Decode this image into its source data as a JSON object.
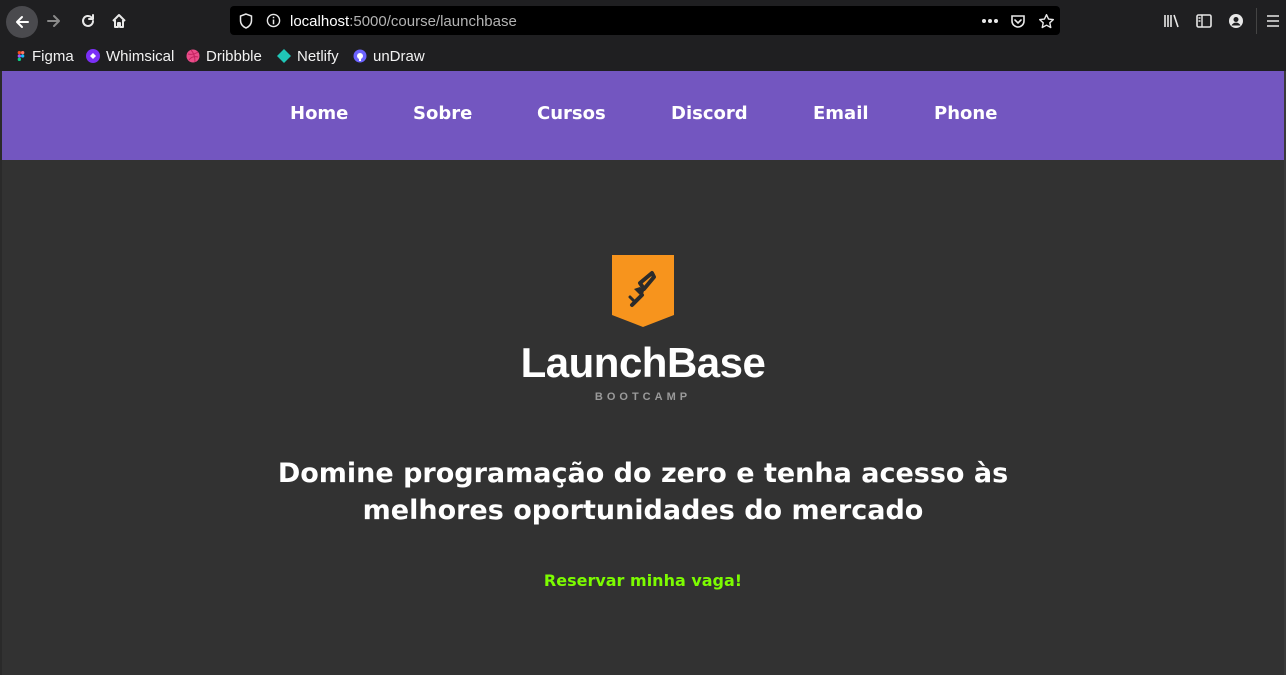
{
  "browser": {
    "url_host": "localhost",
    "url_path": ":5000/course/launchbase",
    "bookmarks": [
      {
        "label": "Figma",
        "icon": "figma-icon"
      },
      {
        "label": "Whimsical",
        "icon": "whimsical-icon"
      },
      {
        "label": "Dribbble",
        "icon": "dribbble-icon"
      },
      {
        "label": "Netlify",
        "icon": "netlify-icon"
      },
      {
        "label": "unDraw",
        "icon": "undraw-icon"
      }
    ]
  },
  "nav": {
    "items": [
      "Home",
      "Sobre",
      "Cursos",
      "Discord",
      "Email",
      "Phone"
    ],
    "background": "#7356c0"
  },
  "brand": {
    "title": "LaunchBase",
    "subtitle": "BOOTCAMP",
    "logo_color": "#f7941d"
  },
  "hero": {
    "headline_line1": "Domine programação do zero e tenha acesso às",
    "headline_line2": "melhores oportunidades do mercado",
    "cta": "Reservar minha vaga!",
    "cta_color": "#7cfc00"
  }
}
